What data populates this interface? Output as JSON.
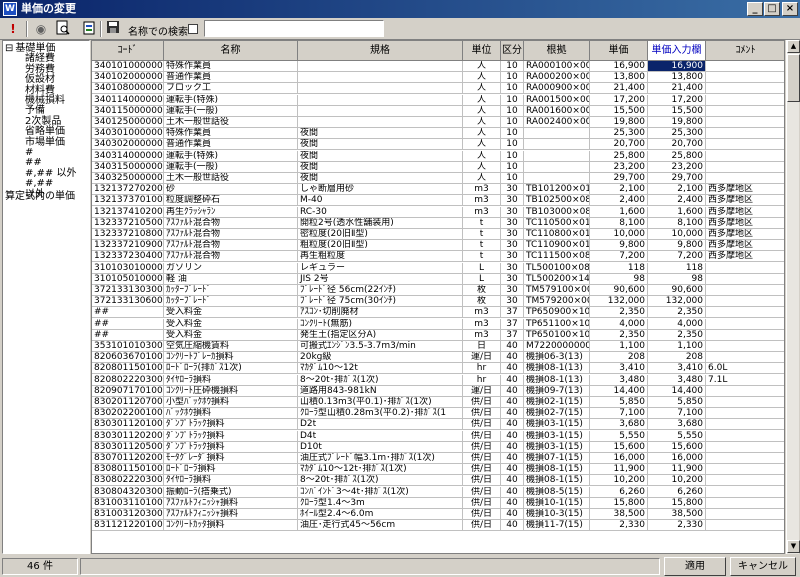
{
  "window": {
    "title": "単価の変更",
    "app_icon": "app-icon"
  },
  "toolbar": {
    "icons": [
      "exclamation-icon",
      "binoculars-icon",
      "preview-icon",
      "export-icon",
      "save-icon"
    ],
    "search_label": "名称での検索",
    "search_value": ""
  },
  "tree": {
    "items": [
      {
        "label": "基礎単価",
        "level": 0,
        "toggle": "⊟"
      },
      {
        "label": "諸経費",
        "level": 1
      },
      {
        "label": "労務費",
        "level": 1
      },
      {
        "label": "仮設材",
        "level": 1
      },
      {
        "label": "材料費",
        "level": 1
      },
      {
        "label": "機械損料",
        "level": 1
      },
      {
        "label": "予備",
        "level": 1
      },
      {
        "label": "2次製品",
        "level": 1
      },
      {
        "label": "省略単価",
        "level": 1
      },
      {
        "label": "市場単価",
        "level": 1
      },
      {
        "label": "#",
        "level": 1
      },
      {
        "label": "##",
        "level": 1
      },
      {
        "label": "#,## 以外",
        "level": 1
      },
      {
        "label": "#,##",
        "level": 1
      },
      {
        "label": "以外",
        "level": 1
      },
      {
        "label": "算定式内の単価",
        "level": 0
      }
    ]
  },
  "grid": {
    "columns": [
      "ｺｰﾄﾞ",
      "名称",
      "規格",
      "単位",
      "区分",
      "根拠",
      "単価",
      "単価入力欄",
      "ｺﾒﾝﾄ"
    ],
    "rows": [
      [
        "340101000000",
        "特殊作業員",
        "",
        "人",
        "10",
        "RA000100×00",
        "16,900",
        "16,900",
        ""
      ],
      [
        "340102000000",
        "普通作業員",
        "",
        "人",
        "10",
        "RA000200×00",
        "13,800",
        "13,800",
        ""
      ],
      [
        "340108000000",
        "ブロック工",
        "",
        "人",
        "10",
        "RA000900×00",
        "21,400",
        "21,400",
        ""
      ],
      [
        "340114000000",
        "運転手(特殊)",
        "",
        "人",
        "10",
        "RA001500×00",
        "17,200",
        "17,200",
        ""
      ],
      [
        "340115000000",
        "運転手(一般)",
        "",
        "人",
        "10",
        "RA001600×00",
        "15,500",
        "15,500",
        ""
      ],
      [
        "340125000000",
        "土木一般世話役",
        "",
        "人",
        "10",
        "RA002400×00",
        "19,800",
        "19,800",
        ""
      ],
      [
        "340301000000",
        "特殊作業員",
        "夜間",
        "人",
        "10",
        "",
        "25,300",
        "25,300",
        ""
      ],
      [
        "340302000000",
        "普通作業員",
        "夜間",
        "人",
        "10",
        "",
        "20,700",
        "20,700",
        ""
      ],
      [
        "340314000000",
        "運転手(特殊)",
        "夜間",
        "人",
        "10",
        "",
        "25,800",
        "25,800",
        ""
      ],
      [
        "340315000000",
        "運転手(一般)",
        "夜間",
        "人",
        "10",
        "",
        "23,200",
        "23,200",
        ""
      ],
      [
        "340325000000",
        "土木一般世話役",
        "夜間",
        "人",
        "10",
        "",
        "29,700",
        "29,700",
        ""
      ],
      [
        "132137270200",
        "砂",
        "しゃ断層用砂",
        "m3",
        "30",
        "TB101200×01",
        "2,100",
        "2,100",
        "西多摩地区"
      ],
      [
        "132137370100",
        "粒度調整砕石",
        "M-40",
        "m3",
        "30",
        "TB102500×08",
        "2,400",
        "2,400",
        "西多摩地区"
      ],
      [
        "132137410200",
        "再生ｸﾗｯｼｬﾗﾝ",
        "RC-30",
        "m3",
        "30",
        "TB103000×08",
        "1,600",
        "1,600",
        "西多摩地区"
      ],
      [
        "132337210500",
        "ｱｽﾌｧﾙﾄ混合物",
        "開粒2号(透水性舗装用)",
        "t",
        "30",
        "TC110500×01",
        "8,100",
        "8,100",
        "西多摩地区"
      ],
      [
        "132337210800",
        "ｱｽﾌｧﾙﾄ混合物",
        "密粒度(20旧Ⅱ型)",
        "t",
        "30",
        "TC110800×01",
        "10,000",
        "10,000",
        "西多摩地区"
      ],
      [
        "132337210900",
        "ｱｽﾌｧﾙﾄ混合物",
        "粗粒度(20旧Ⅱ型)",
        "t",
        "30",
        "TC110900×01",
        "9,800",
        "9,800",
        "西多摩地区"
      ],
      [
        "132337230400",
        "ｱｽﾌｧﾙﾄ混合物",
        "再生粗粒度",
        "t",
        "30",
        "TC111500×08",
        "7,200",
        "7,200",
        "西多摩地区"
      ],
      [
        "310103010000",
        "ガソリン",
        "レギュラー",
        "L",
        "30",
        "TL500100×08",
        "118",
        "118",
        ""
      ],
      [
        "310105010000",
        "軽 油",
        "JIS 2号",
        "L",
        "30",
        "TL500200×14",
        "98",
        "98",
        ""
      ],
      [
        "372133130300",
        "ｶｯﾀｰﾌﾞﾚｰﾄﾞ",
        "ﾌﾞﾚｰﾄﾞ径 56cm(22ｲﾝﾁ)",
        "枚",
        "30",
        "TM579100×00",
        "90,600",
        "90,600",
        ""
      ],
      [
        "372133130600",
        "ｶｯﾀｰﾌﾞﾚｰﾄﾞ",
        "ﾌﾞﾚｰﾄﾞ径 75cm(30ｲﾝﾁ)",
        "枚",
        "30",
        "TM579200×00",
        "132,000",
        "132,000",
        ""
      ],
      [
        "##",
        "受入料金",
        "ｱｽｺﾝ･切削廃材",
        "m3",
        "37",
        "TP650900×10",
        "2,350",
        "2,350",
        ""
      ],
      [
        "##",
        "受入料金",
        "ｺﾝｸﾘｰﾄ(無筋)",
        "m3",
        "37",
        "TP651100×10",
        "4,000",
        "4,000",
        ""
      ],
      [
        "##",
        "受入料金",
        "発生土(指定区分A)",
        "m3",
        "37",
        "TP650100×10",
        "2,350",
        "2,350",
        ""
      ],
      [
        "353101010300",
        "空気圧縮機賃料",
        "可搬式ｴﾝｼﾞﾝ3.5-3.7m3/min",
        "日",
        "40",
        "M7220000000",
        "1,100",
        "1,100",
        ""
      ],
      [
        "820603670100",
        "ｺﾝｸﾘｰﾄﾌﾞﾚｰｶ損料",
        "20kg級",
        "運/日",
        "40",
        "機損06-3(13)",
        "208",
        "208",
        ""
      ],
      [
        "820801150100",
        "ﾛｰﾄﾞﾛｰﾗ(排ｶﾞｽ1次)",
        "ﾏｶﾀﾞﾑ10～12t",
        "hr",
        "40",
        "機損08-1(13)",
        "3,410",
        "3,410",
        "6.0L"
      ],
      [
        "820802220300",
        "ﾀｲﾔﾛｰﾗ損料",
        "8～20t･排ｶﾞｽ(1次)",
        "hr",
        "40",
        "機損08-1(13)",
        "3,480",
        "3,480",
        "7.1L"
      ],
      [
        "820907170100",
        "ｺﾝｸﾘｰﾄ圧砕機損料",
        "道路用843-981kN",
        "運/日",
        "40",
        "機損09-7(13)",
        "14,400",
        "14,400",
        ""
      ],
      [
        "830201120700",
        "小型ﾊﾞｯｸﾎｳ損料",
        "山積0.13m3(平0.1)･排ｶﾞｽ(1次)",
        "供/日",
        "40",
        "機損02-1(15)",
        "5,850",
        "5,850",
        ""
      ],
      [
        "830202200100",
        "ﾊﾞｯｸﾎｳ損料",
        "ｸﾛｰﾗ型山積0.28m3(平0.2)･排ｶﾞｽ(1",
        "供/日",
        "40",
        "機損02-7(15)",
        "7,100",
        "7,100",
        ""
      ],
      [
        "830301120100",
        "ﾀﾞﾝﾌﾟﾄﾗｯｸ損料",
        "D2t",
        "供/日",
        "40",
        "機損03-1(15)",
        "3,680",
        "3,680",
        ""
      ],
      [
        "830301120200",
        "ﾀﾞﾝﾌﾟﾄﾗｯｸ損料",
        "D4t",
        "供/日",
        "40",
        "機損03-1(15)",
        "5,550",
        "5,550",
        ""
      ],
      [
        "830301120500",
        "ﾀﾞﾝﾌﾟﾄﾗｯｸ損料",
        "D10t",
        "供/日",
        "40",
        "機損03-1(15)",
        "15,600",
        "15,600",
        ""
      ],
      [
        "830701120200",
        "ﾓｰﾀｸﾞﾚｰﾀﾞ損料",
        "油圧式ﾌﾞﾚｰﾄﾞ幅3.1m･排ｶﾞｽ(1次)",
        "供/日",
        "40",
        "機損07-1(15)",
        "16,000",
        "16,000",
        ""
      ],
      [
        "830801150100",
        "ﾛｰﾄﾞﾛｰﾗ損料",
        "ﾏｶﾀﾞﾑ10～12t･排ｶﾞｽ(1次)",
        "供/日",
        "40",
        "機損08-1(15)",
        "11,900",
        "11,900",
        ""
      ],
      [
        "830802220300",
        "ﾀｲﾔﾛｰﾗ損料",
        "8～20t･排ｶﾞｽ(1次)",
        "供/日",
        "40",
        "機損08-1(15)",
        "10,200",
        "10,200",
        ""
      ],
      [
        "830804320300",
        "振動ﾛｰﾗ(搭乗式)",
        "ｺﾝﾊﾞｲﾝﾄﾞ3～4t･排ｶﾞｽ(1次)",
        "供/日",
        "40",
        "機損08-5(15)",
        "6,260",
        "6,260",
        ""
      ],
      [
        "831003110100",
        "ｱｽﾌｧﾙﾄﾌｨﾆｯｼｬ損料",
        "ｸﾛｰﾗ型1.4～3m",
        "供/日",
        "40",
        "機損10-1(15)",
        "15,800",
        "15,800",
        ""
      ],
      [
        "831003120300",
        "ｱｽﾌｧﾙﾄﾌｨﾆｯｼｬ損料",
        "ﾎｲｰﾙ型2.4～6.0m",
        "供/日",
        "40",
        "機損10-3(15)",
        "38,500",
        "38,500",
        ""
      ],
      [
        "831121220100",
        "ｺﾝｸﾘｰﾄｶｯﾀ損料",
        "油圧･走行式45～56cm",
        "供/日",
        "40",
        "機損11-7(15)",
        "2,330",
        "2,330",
        ""
      ]
    ]
  },
  "status": {
    "count": "46 件"
  },
  "buttons": {
    "apply": "適用",
    "cancel": "キャンセル"
  }
}
